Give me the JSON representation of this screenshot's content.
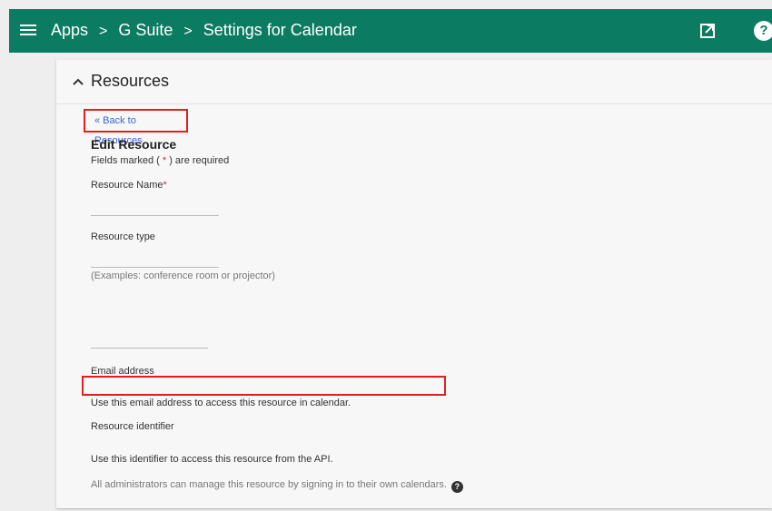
{
  "topbar": {
    "breadcrumbs": [
      "Apps",
      "G Suite",
      "Settings for Calendar"
    ],
    "separator": ">"
  },
  "card": {
    "section_title": "Resources",
    "back_link": "« Back to Resources",
    "heading": "Edit Resource",
    "required_prefix": "Fields marked ( ",
    "required_star": "*",
    "required_suffix": " ) are required",
    "resource_name_label": "Resource Name",
    "resource_type_label": "Resource type",
    "resource_type_hint": "(Examples: conference room or projector)",
    "email_label": "Email address",
    "email_hint": "Use this email address to access this resource in calendar.",
    "identifier_label": "Resource identifier",
    "identifier_hint": "Use this identifier to access this resource from the API.",
    "admin_note": "All administrators can manage this resource by signing in to their own calendars."
  },
  "colors": {
    "topbar": "#0b7b62",
    "link": "#3367d6",
    "highlight_border": "#e02020",
    "required_star": "#d32f2f"
  },
  "icons": [
    "menu-icon",
    "open-in-new-icon",
    "help-icon",
    "chevron-up-icon",
    "question-icon"
  ]
}
